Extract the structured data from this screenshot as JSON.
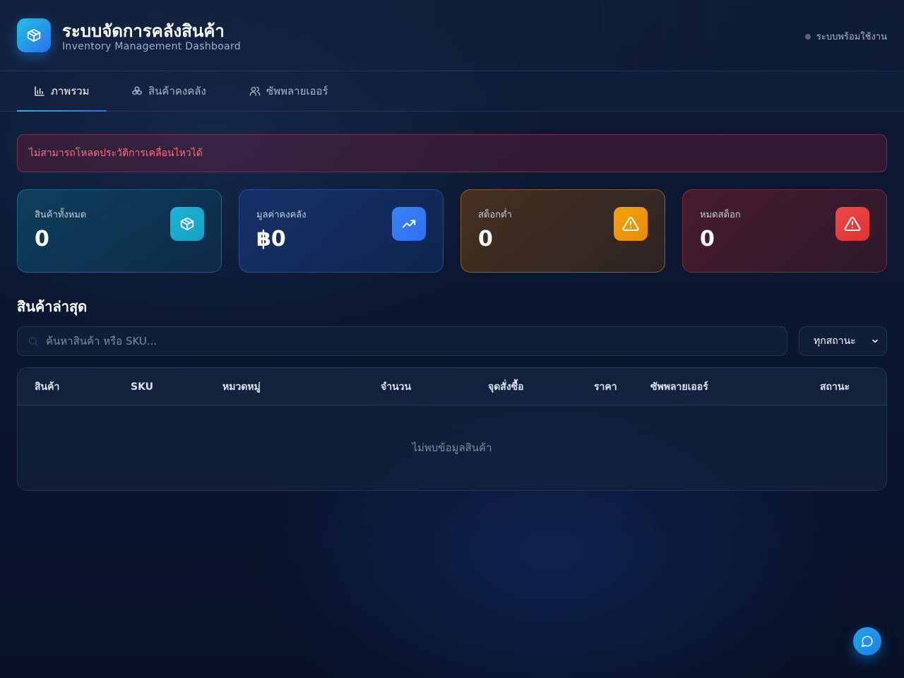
{
  "header": {
    "title": "ระบบจัดการคลังสินค้า",
    "subtitle": "Inventory Management Dashboard",
    "status_text": "ระบบพร้อมใช้งาน",
    "logo_icon": "package-icon"
  },
  "tabs": [
    {
      "label": "ภาพรวม",
      "icon": "bar-chart-icon",
      "active": true
    },
    {
      "label": "สินค้าคงคลัง",
      "icon": "boxes-icon",
      "active": false
    },
    {
      "label": "ซัพพลายเออร์",
      "icon": "users-icon",
      "active": false
    }
  ],
  "alert": {
    "message": "ไม่สามารถโหลดประวัติการเคลื่อนไหวได้"
  },
  "stats": [
    {
      "label": "สินค้าทั้งหมด",
      "value": "0",
      "icon": "package-icon",
      "color": "#1ab6d6"
    },
    {
      "label": "มูลค่าคงคลัง",
      "value": "฿0",
      "icon": "trending-up-icon",
      "color": "#3b82f6"
    },
    {
      "label": "สต็อกต่ำ",
      "value": "0",
      "icon": "warning-icon",
      "color": "#f5a20c"
    },
    {
      "label": "หมดสต็อก",
      "value": "0",
      "icon": "warning-icon",
      "color": "#f04848"
    }
  ],
  "section": {
    "title": "สินค้าล่าสุด"
  },
  "search": {
    "placeholder": "ค้นหาสินค้า หรือ SKU..."
  },
  "filter": {
    "selected": "ทุกสถานะ"
  },
  "table": {
    "columns": [
      "สินค้า",
      "SKU",
      "หมวดหมู่",
      "จำนวน",
      "จุดสั่งซื้อ",
      "ราคา",
      "ซัพพลายเออร์",
      "สถานะ"
    ],
    "empty_text": "ไม่พบข้อมูลสินค้า"
  },
  "fab": {
    "icon": "chat-icon"
  }
}
